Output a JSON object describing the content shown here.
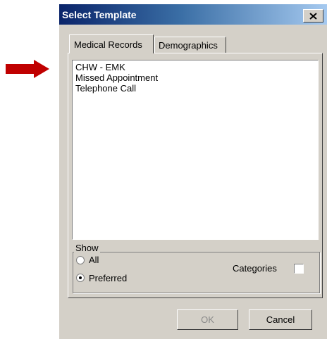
{
  "window": {
    "title": "Select Template"
  },
  "tabs": [
    {
      "label": "Medical Records"
    },
    {
      "label": "Demographics"
    }
  ],
  "templates": [
    {
      "label": "CHW - EMK"
    },
    {
      "label": "Missed Appointment"
    },
    {
      "label": "Telephone Call"
    }
  ],
  "show_group": {
    "legend": "Show",
    "options": [
      {
        "label": "All",
        "selected": false
      },
      {
        "label": "Preferred",
        "selected": true
      }
    ],
    "categories_label": "Categories",
    "categories_checked": false
  },
  "buttons": {
    "ok": "OK",
    "cancel": "Cancel"
  },
  "colors": {
    "annotation_arrow": "#c00000",
    "titlebar_start": "#0a246a",
    "titlebar_end": "#a6caf0"
  },
  "icons": {
    "close": "close-icon",
    "pointer": "arrow-right-icon"
  }
}
